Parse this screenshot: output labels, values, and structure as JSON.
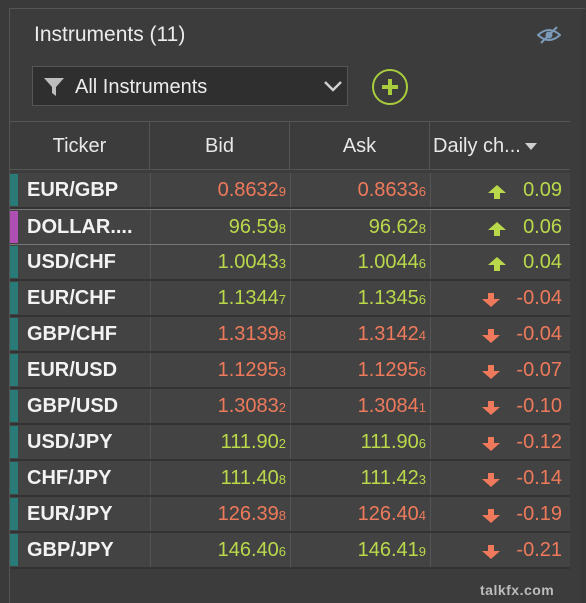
{
  "header": {
    "title": "Instruments (11)",
    "visibility_icon": "eye-off-icon"
  },
  "filter": {
    "label": "All Instruments",
    "icon": "filter-icon"
  },
  "columns": {
    "ticker": "Ticker",
    "bid": "Bid",
    "ask": "Ask",
    "change": "Daily ch..."
  },
  "colors": {
    "up": "#b9d94b",
    "down": "#ee7a5b",
    "stripe": "#2a7a78",
    "stripe_alt": "#b04fb3",
    "accent": "#a9cc3d"
  },
  "rows": [
    {
      "ticker": "EUR/GBP",
      "bid_main": "0.8632",
      "bid_pip": "9",
      "ask_main": "0.8633",
      "ask_pip": "6",
      "change": "0.09",
      "dir": "up",
      "price_dir": "down",
      "stripe": "teal"
    },
    {
      "ticker": "DOLLAR....",
      "bid_main": "96.59",
      "bid_pip": "8",
      "ask_main": "96.62",
      "ask_pip": "8",
      "change": "0.06",
      "dir": "up",
      "price_dir": "up",
      "stripe": "purple",
      "selected": true
    },
    {
      "ticker": "USD/CHF",
      "bid_main": "1.0043",
      "bid_pip": "3",
      "ask_main": "1.0044",
      "ask_pip": "6",
      "change": "0.04",
      "dir": "up",
      "price_dir": "up",
      "stripe": "teal"
    },
    {
      "ticker": "EUR/CHF",
      "bid_main": "1.1344",
      "bid_pip": "7",
      "ask_main": "1.1345",
      "ask_pip": "6",
      "change": "-0.04",
      "dir": "down",
      "price_dir": "up",
      "stripe": "teal"
    },
    {
      "ticker": "GBP/CHF",
      "bid_main": "1.3139",
      "bid_pip": "8",
      "ask_main": "1.3142",
      "ask_pip": "4",
      "change": "-0.04",
      "dir": "down",
      "price_dir": "down",
      "stripe": "teal"
    },
    {
      "ticker": "EUR/USD",
      "bid_main": "1.1295",
      "bid_pip": "3",
      "ask_main": "1.1295",
      "ask_pip": "6",
      "change": "-0.07",
      "dir": "down",
      "price_dir": "down",
      "stripe": "teal"
    },
    {
      "ticker": "GBP/USD",
      "bid_main": "1.3083",
      "bid_pip": "2",
      "ask_main": "1.3084",
      "ask_pip": "1",
      "change": "-0.10",
      "dir": "down",
      "price_dir": "down",
      "stripe": "teal"
    },
    {
      "ticker": "USD/JPY",
      "bid_main": "111.90",
      "bid_pip": "2",
      "ask_main": "111.90",
      "ask_pip": "6",
      "change": "-0.12",
      "dir": "down",
      "price_dir": "up",
      "stripe": "teal"
    },
    {
      "ticker": "CHF/JPY",
      "bid_main": "111.40",
      "bid_pip": "8",
      "ask_main": "111.42",
      "ask_pip": "3",
      "change": "-0.14",
      "dir": "down",
      "price_dir": "up",
      "stripe": "teal"
    },
    {
      "ticker": "EUR/JPY",
      "bid_main": "126.39",
      "bid_pip": "8",
      "ask_main": "126.40",
      "ask_pip": "4",
      "change": "-0.19",
      "dir": "down",
      "price_dir": "down",
      "stripe": "teal"
    },
    {
      "ticker": "GBP/JPY",
      "bid_main": "146.40",
      "bid_pip": "6",
      "ask_main": "146.41",
      "ask_pip": "9",
      "change": "-0.21",
      "dir": "down",
      "price_dir": "up",
      "stripe": "teal"
    }
  ],
  "watermark": "talkfx.com"
}
